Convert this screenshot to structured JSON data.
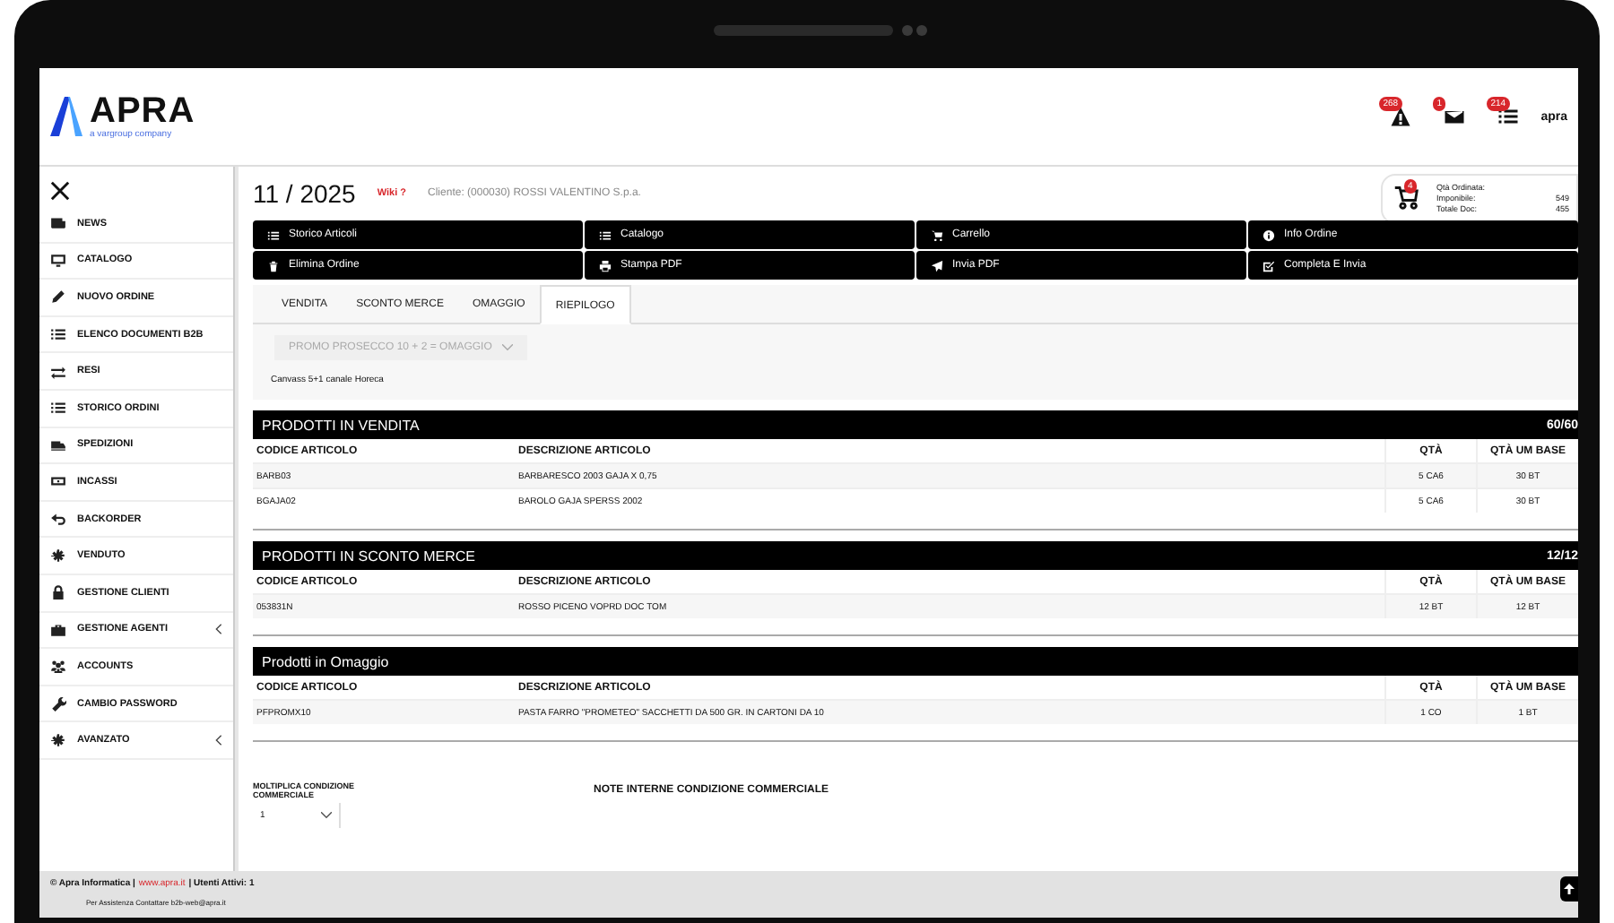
{
  "brand": {
    "name": "APRA",
    "tagline": "a vargroup company"
  },
  "header": {
    "alerts": [
      {
        "count": "268"
      },
      {
        "count": "1"
      },
      {
        "count": "214"
      }
    ],
    "user": "apra"
  },
  "sidebar": {
    "items": [
      {
        "label": "NEWS",
        "expandable": false
      },
      {
        "label": "CATALOGO",
        "expandable": false
      },
      {
        "label": "NUOVO ORDINE",
        "expandable": false
      },
      {
        "label": "ELENCO DOCUMENTI B2B",
        "expandable": false
      },
      {
        "label": "RESI",
        "expandable": false
      },
      {
        "label": "STORICO ORDINI",
        "expandable": false
      },
      {
        "label": "SPEDIZIONI",
        "expandable": false
      },
      {
        "label": "INCASSI",
        "expandable": false
      },
      {
        "label": "BACKORDER",
        "expandable": false
      },
      {
        "label": "VENDUTO",
        "expandable": false
      },
      {
        "label": "GESTIONE CLIENTI",
        "expandable": false
      },
      {
        "label": "GESTIONE AGENTI",
        "expandable": true
      },
      {
        "label": "ACCOUNTS",
        "expandable": false
      },
      {
        "label": "CAMBIO PASSWORD",
        "expandable": false
      },
      {
        "label": "AVANZATO",
        "expandable": true
      }
    ]
  },
  "order": {
    "number": "11 / 2025",
    "wiki": "Wiki ?",
    "client": "Cliente: (000030) ROSSI VALENTINO S.p.a."
  },
  "cart": {
    "badge": "4",
    "rows": [
      {
        "label": "Qtà Ordinata:"
      },
      {
        "label": "Imponibile:",
        "value": "549"
      },
      {
        "label": "Totale Doc:",
        "value": "455"
      }
    ]
  },
  "actions": [
    "Storico Articoli",
    "Catalogo",
    "Carrello",
    "Info Ordine",
    "Elimina Ordine",
    "Stampa PDF",
    "Invia PDF",
    "Completa E Invia"
  ],
  "tabs": [
    {
      "label": "VENDITA",
      "selected": false
    },
    {
      "label": "SCONTO MERCE",
      "selected": false
    },
    {
      "label": "OMAGGIO",
      "selected": false
    },
    {
      "label": "RIEPILOGO",
      "selected": true
    }
  ],
  "promo": {
    "disabled": true,
    "value": "PROMO PROSECCO 10 + 2 = OMAGGIO",
    "note": "Canvass 5+1 canale Horeca"
  },
  "sections": [
    {
      "title": "PRODOTTI IN VENDITA",
      "count": "60/60",
      "columns": [
        "CODICE ARTICOLO",
        "DESCRIZIONE ARTICOLO",
        "QTÀ",
        "QTÀ UM BASE"
      ],
      "rows": [
        [
          "BARB03",
          "BARBARESCO 2003 GAJA X 0,75",
          "5 CA6",
          "30 BT"
        ],
        [
          "BGAJA02",
          "BAROLO GAJA SPERSS 2002",
          "5 CA6",
          "30 BT"
        ]
      ]
    },
    {
      "title": "PRODOTTI IN SCONTO MERCE",
      "count": "12/12",
      "columns": [
        "CODICE ARTICOLO",
        "DESCRIZIONE ARTICOLO",
        "QTÀ",
        "QTÀ UM BASE"
      ],
      "rows": [
        [
          "053831N",
          "ROSSO PICENO VOPRD DOC TOM",
          "12 BT",
          "12 BT"
        ]
      ]
    },
    {
      "title": "Prodotti in Omaggio",
      "columns": [
        "CODICE ARTICOLO",
        "DESCRIZIONE ARTICOLO",
        "QTÀ",
        "QTÀ UM BASE"
      ],
      "rows": [
        [
          "PFPROMX10",
          "PASTA FARRO \"PROMETEO\" SACCHETTI DA 500 GR. IN CARTONI DA 10",
          "1 CO",
          "1 BT"
        ]
      ]
    }
  ],
  "multiplier": {
    "label": "MOLTIPLICA CONDIZIONE COMMERCIALE",
    "value": "1"
  },
  "notes": {
    "label": "NOTE INTERNE CONDIZIONE COMMERCIALE"
  },
  "footer": {
    "copyright": "© Apra Informatica |",
    "link": "www.apra.it",
    "users": "| Utenti Attivi: 1",
    "support": "Per Assistenza Contattare b2b-web@apra.it"
  }
}
